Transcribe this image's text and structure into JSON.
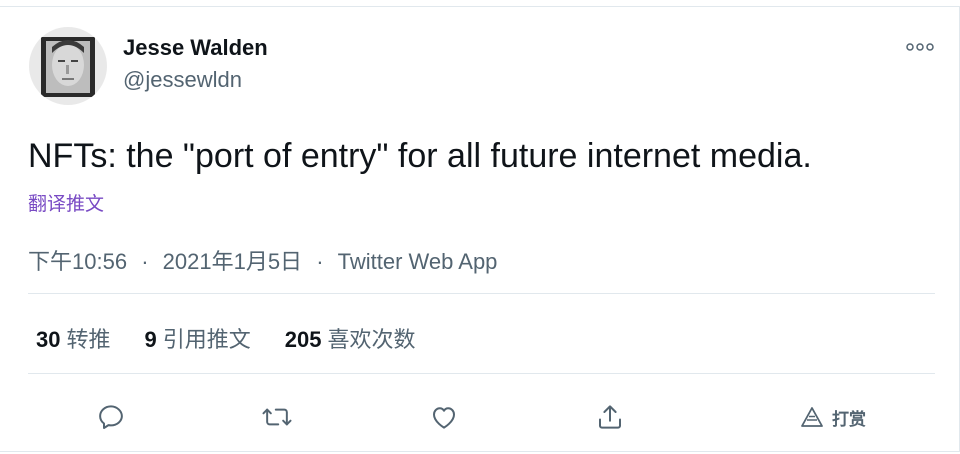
{
  "author": {
    "display_name": "Jesse Walden",
    "handle": "@jessewldn",
    "avatar": "avatar-portrait"
  },
  "tweet": {
    "text": "NFTs: the \"port of entry\" for all future internet media.",
    "translate_label": "翻译推文",
    "time": "下午10:56",
    "date": "2021年1月5日",
    "separator": "·",
    "source": "Twitter Web App"
  },
  "stats": {
    "retweets_count": "30",
    "retweets_label": "转推",
    "quotes_count": "9",
    "quotes_label": "引用推文",
    "likes_count": "205",
    "likes_label": "喜欢次数"
  },
  "actions": {
    "reply_icon": "reply-icon",
    "retweet_icon": "retweet-icon",
    "like_icon": "like-icon",
    "share_icon": "share-icon",
    "tip_icon": "tip-icon",
    "tip_label": "打赏"
  },
  "colors": {
    "text": "#0f1419",
    "secondary": "#536471",
    "translate": "#794bc4",
    "border": "#e1e8ed"
  }
}
